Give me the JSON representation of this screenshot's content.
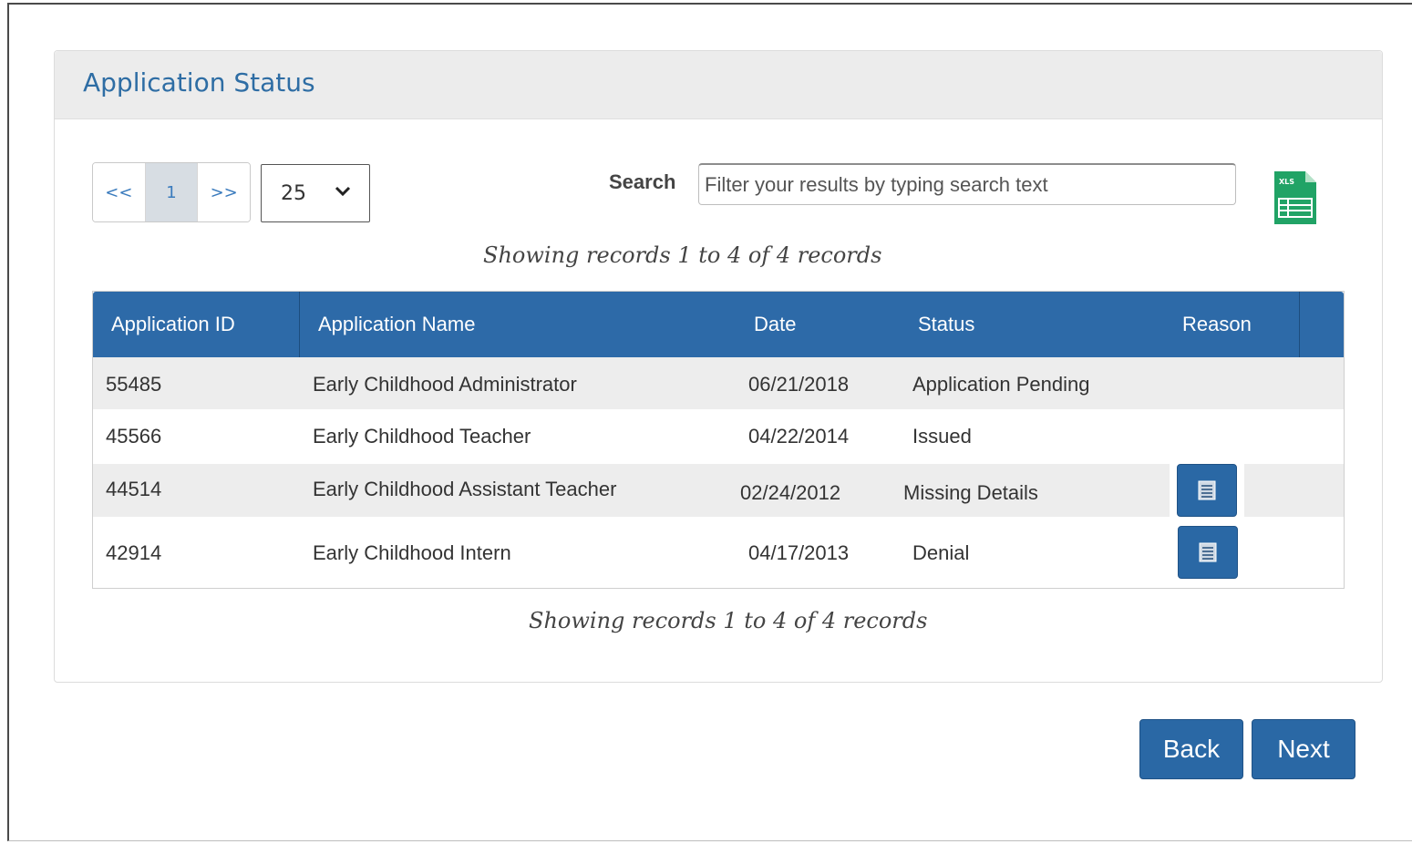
{
  "panel": {
    "title": "Application Status"
  },
  "pagination": {
    "first_label": "<<",
    "current_page": "1",
    "next_label": ">>",
    "page_size": "25"
  },
  "search": {
    "label": "Search",
    "placeholder": "Filter your results by typing search text",
    "value": ""
  },
  "export": {
    "icon": "xls-spreadsheet-icon",
    "badge_text": "XLS"
  },
  "records_info": {
    "top": "Showing records 1 to 4 of 4 records",
    "bottom": "Showing records 1 to 4 of 4 records"
  },
  "table": {
    "columns": [
      "Application ID",
      "Application Name",
      "Date",
      "Status",
      "Reason"
    ],
    "rows": [
      {
        "id": "55485",
        "name": "Early Childhood Administrator",
        "date": "06/21/2018",
        "status": "Application Pending",
        "has_reason": false
      },
      {
        "id": "45566",
        "name": "Early Childhood Teacher",
        "date": "04/22/2014",
        "status": "Issued",
        "has_reason": false
      },
      {
        "id": "44514",
        "name": "Early Childhood Assistant Teacher",
        "date": "02/24/2012",
        "status": "Missing Details",
        "has_reason": true
      },
      {
        "id": "42914",
        "name": "Early Childhood Intern",
        "date": "04/17/2013",
        "status": "Denial",
        "has_reason": true
      }
    ],
    "reason_icon": "document-list-icon"
  },
  "nav": {
    "back_label": "Back",
    "next_label": "Next"
  },
  "colors": {
    "primary": "#2d6aa8",
    "title": "#2e6da4",
    "excel_green": "#21a366"
  }
}
